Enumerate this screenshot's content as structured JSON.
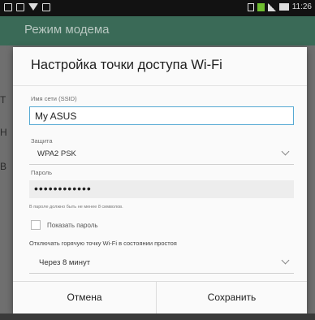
{
  "status_bar": {
    "time": "11:26",
    "icons": [
      "image-icon",
      "message-icon",
      "wifi-icon",
      "sd-card-icon",
      "mute-icon",
      "sim-icon",
      "signal-icon",
      "battery-icon"
    ]
  },
  "app_bar": {
    "title": "Режим модема"
  },
  "background_letters": [
    "Т",
    "Н",
    "В"
  ],
  "dialog": {
    "title": "Настройка точки доступа Wi-Fi",
    "ssid": {
      "label": "Имя сети (SSID)",
      "value": "My ASUS"
    },
    "security": {
      "label": "Защита",
      "value": "WPA2 PSK"
    },
    "password": {
      "label": "Пароль",
      "value": "••••••••••••",
      "hint": "В пароле должно быть не менее 8 символов."
    },
    "show_password": {
      "label": "Показать пароль",
      "checked": false
    },
    "idle": {
      "label": "Отключать горячую точку Wi-Fi в состоянии простоя",
      "value": "Через 8 минут"
    },
    "buttons": {
      "cancel": "Отмена",
      "save": "Сохранить"
    }
  },
  "colors": {
    "accent": "#56a9d3",
    "app_bar": "#3a6a57"
  }
}
